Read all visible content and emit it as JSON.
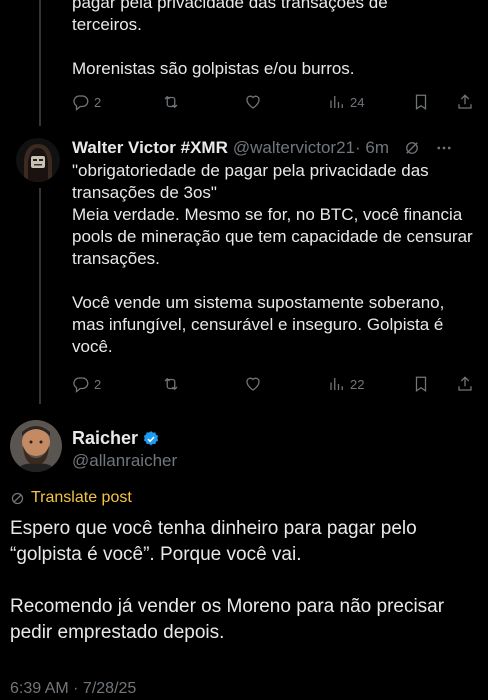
{
  "tweet1": {
    "lines": [
      "pagar pela privacidade das transações de",
      "terceiros.",
      "Morenistas são golpistas e/ou burros."
    ],
    "replies": "2",
    "views": "24"
  },
  "tweet2": {
    "name": "Walter Victor #XMR",
    "handle": "@waltervictor21",
    "time": "· 6m",
    "para1": "\"obrigatoriedade de pagar pela privacidade das transações de 3os\"",
    "para2": "Meia verdade. Mesmo se for, no BTC, você financia pools de mineração que tem capacidade de censurar transações.",
    "para3": "Você vende um sistema supostamente soberano, mas infungível, censurável e inseguro. Golpista é você.",
    "replies": "2",
    "views": "22"
  },
  "tweet3": {
    "name": "Raicher",
    "handle": "@allanraicher",
    "translate": "Translate post",
    "para1": "Espero que você tenha dinheiro para pagar pelo “golpista é você”. Porque você vai.",
    "para2": "Recomendo já vender os Moreno para não precisar pedir emprestado depois.",
    "meta": "6:39 AM · 7/28/25"
  },
  "colors": {
    "background": "#000000",
    "text": "#e7e9ea",
    "muted": "#71767b",
    "verified": "#1d9bf0",
    "translate": "#f5c542"
  },
  "icons": [
    "reply-icon",
    "retweet-icon",
    "like-icon",
    "views-icon",
    "bookmark-icon",
    "share-icon",
    "grok-icon",
    "more-icon",
    "verified-icon",
    "translate-icon"
  ]
}
